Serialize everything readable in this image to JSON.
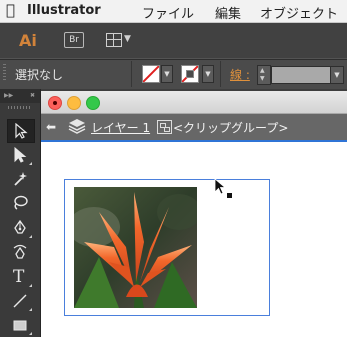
{
  "menubar": {
    "apple_icon": "apple-icon",
    "app_name": "Illustrator",
    "items": [
      "ファイル",
      "編集",
      "オブジェクト"
    ]
  },
  "appbar": {
    "logo": "Ai",
    "bridge_button": "Br",
    "workspace_icon": "layout-grid-icon"
  },
  "control_bar": {
    "selection_status": "選択なし",
    "stroke_label": "線 :",
    "stroke_value": "",
    "fill_color": "none",
    "accent_color": "#e0913c"
  },
  "isolation_bar": {
    "back_icon": "arrow-left-icon",
    "layers_icon": "layers-icon",
    "layer_name": "レイヤー 1",
    "group_name": "<クリップグループ>",
    "highlight_color": "#2f74d6"
  },
  "tools": [
    {
      "name": "selection-tool",
      "icon": "arrow-icon",
      "active": true
    },
    {
      "name": "direct-selection-tool",
      "icon": "hollow-arrow-icon"
    },
    {
      "name": "magic-wand-tool",
      "icon": "magic-wand-icon"
    },
    {
      "name": "lasso-tool",
      "icon": "lasso-icon"
    },
    {
      "name": "pen-tool",
      "icon": "pen-icon"
    },
    {
      "name": "curvature-tool",
      "icon": "curvature-pen-icon"
    },
    {
      "name": "type-tool",
      "label": "T"
    },
    {
      "name": "line-tool",
      "icon": "line-icon"
    },
    {
      "name": "rectangle-tool",
      "icon": "rectangle-icon"
    }
  ]
}
